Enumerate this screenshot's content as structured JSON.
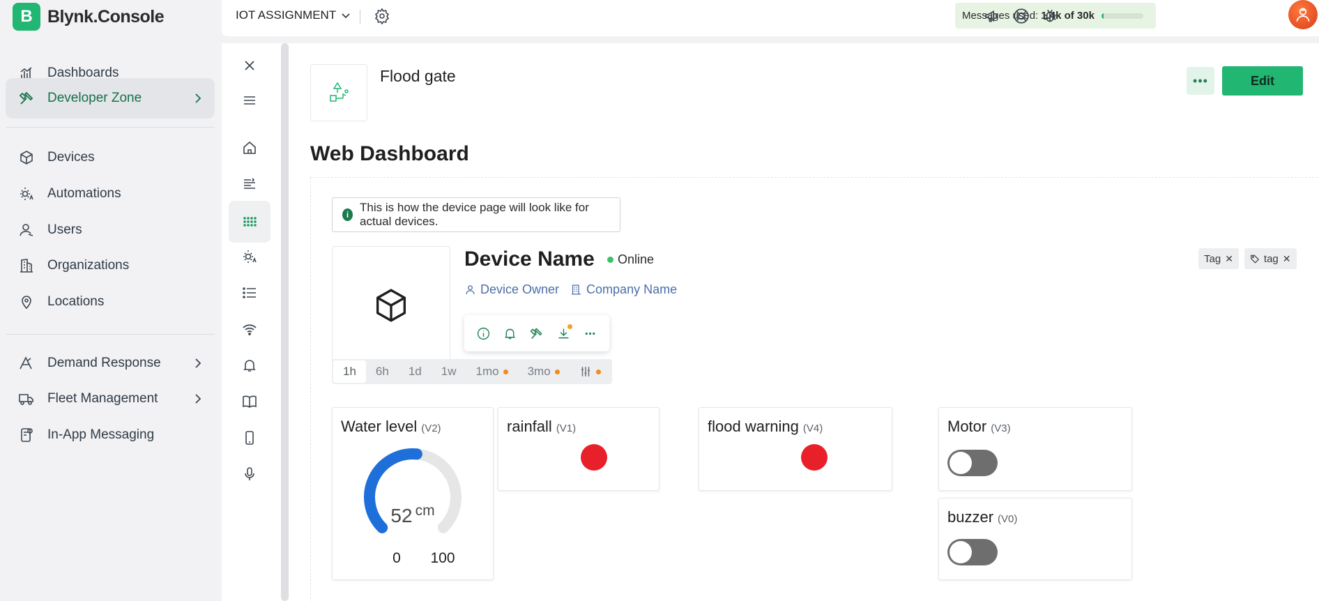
{
  "brand": {
    "logo_letter": "B",
    "name": "Blynk.Console"
  },
  "sidebar": {
    "items": [
      {
        "label": "Dashboards",
        "icon": "bar-chart-icon"
      },
      {
        "label": "Developer Zone",
        "icon": "tools-icon",
        "active": true
      },
      {
        "label": "Devices",
        "icon": "cube-icon"
      },
      {
        "label": "Automations",
        "icon": "sun-automation-icon"
      },
      {
        "label": "Users",
        "icon": "user-icon"
      },
      {
        "label": "Organizations",
        "icon": "building-icon"
      },
      {
        "label": "Locations",
        "icon": "pin-icon"
      },
      {
        "label": "Demand Response",
        "icon": "demand-icon"
      },
      {
        "label": "Fleet Management",
        "icon": "truck-icon"
      },
      {
        "label": "In-App Messaging",
        "icon": "message-icon"
      }
    ]
  },
  "topbar": {
    "org_name": "IOT ASSIGNMENT",
    "messages_label": "Messages used:",
    "messages_value": "1.4k of 30k",
    "messages_fraction": 0.047
  },
  "template": {
    "name": "Flood gate",
    "edit_label": "Edit",
    "more_label": "•••",
    "section_title": "Web Dashboard"
  },
  "preview": {
    "info_icon": "i",
    "info_text": "This is how the device page will look like for actual devices.",
    "device_name": "Device Name",
    "status": "Online",
    "owner": "Device Owner",
    "company": "Company Name",
    "tags": [
      "Tag",
      "tag"
    ],
    "time_tabs": [
      "1h",
      "6h",
      "1d",
      "1w",
      "1mo",
      "3mo"
    ]
  },
  "widgets": {
    "water_level": {
      "title": "Water level",
      "pin": "(V2)",
      "value": "52",
      "unit": "cm",
      "min": "0",
      "max": "100",
      "color": "#1e6fd9"
    },
    "rainfall": {
      "title": "rainfall",
      "pin": "(V1)",
      "led_color": "#e8202a"
    },
    "flood_warning": {
      "title": "flood warning",
      "pin": "(V4)",
      "led_color": "#e8202a"
    },
    "motor": {
      "title": "Motor",
      "pin": "(V3)",
      "state": "off"
    },
    "buzzer": {
      "title": "buzzer",
      "pin": "(V0)",
      "state": "off"
    }
  },
  "colors": {
    "brand_green": "#22b673",
    "active_green": "#157247",
    "led_red": "#e8202a",
    "gauge_blue": "#1e6fd9"
  }
}
